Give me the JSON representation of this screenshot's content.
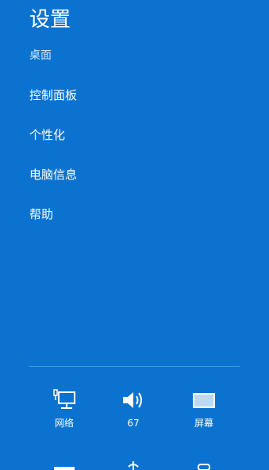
{
  "header": {
    "title": "设置",
    "subtitle": "桌面"
  },
  "menu": {
    "items": [
      {
        "label": "控制面板"
      },
      {
        "label": "个性化"
      },
      {
        "label": "电脑信息"
      },
      {
        "label": "帮助"
      }
    ]
  },
  "quick_settings": {
    "network": {
      "label": "网络",
      "icon": "network-icon"
    },
    "volume": {
      "label": "67",
      "icon": "volume-icon"
    },
    "screen": {
      "label": "屏幕",
      "icon": "screen-icon"
    }
  },
  "colors": {
    "background": "#0b73cf",
    "text": "#ffffff",
    "subtitle": "#cfe3f6",
    "divider": "#4d98dc"
  }
}
